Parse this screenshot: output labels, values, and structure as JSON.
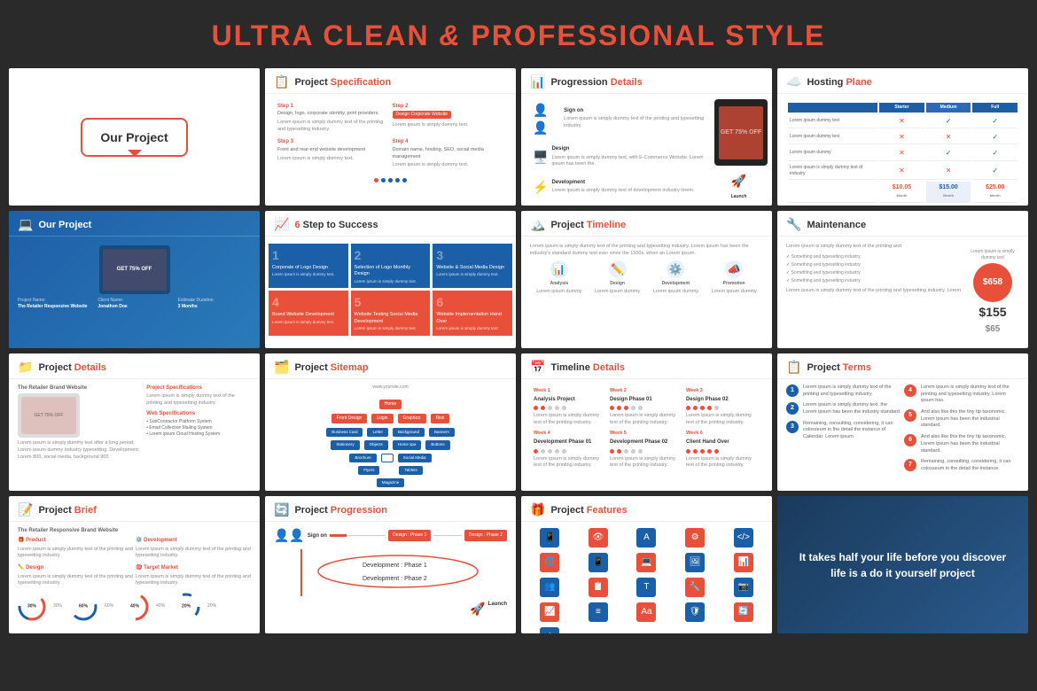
{
  "header": {
    "title_part1": "ULTRA CLEAN",
    "title_amp": " & ",
    "title_part2": "PROFESSIONAL STYLE"
  },
  "slides": [
    {
      "id": "slide-1",
      "type": "our-project-simple",
      "title": "Our Project"
    },
    {
      "id": "slide-2",
      "type": "project-specification",
      "title": "Project  Specification",
      "icon": "📋",
      "steps": [
        "Step 1",
        "Step 2",
        "Step 3",
        "Step 4"
      ]
    },
    {
      "id": "slide-3",
      "type": "progression-details",
      "title": "Progression Details",
      "icon": "📊",
      "items": [
        "Sign on",
        "Design",
        "Development"
      ]
    },
    {
      "id": "slide-4",
      "type": "hosting-plane",
      "title": "Hosting Plane",
      "icon": "☁️",
      "plans": [
        "Starter",
        "Medium",
        "Full"
      ],
      "prices": [
        "$10.05",
        "$15.00",
        "$25.00"
      ]
    },
    {
      "id": "slide-5",
      "type": "our-project-blue",
      "title": "Our Project",
      "icon": "💻",
      "project_name": "The Retailer Responsive Website",
      "client": "Jonathon Doe",
      "duration": "3 Months"
    },
    {
      "id": "slide-6",
      "type": "step-to-success",
      "title": "6 Step to Success",
      "icon": "📈",
      "steps": [
        {
          "num": "1",
          "title": "Corporate of Logo Design"
        },
        {
          "num": "2",
          "title": "Selection of Logo Monthly Design"
        },
        {
          "num": "3",
          "title": "Website & Social Media Design"
        },
        {
          "num": "4",
          "title": "Brand Website Development"
        },
        {
          "num": "5",
          "title": "Website Testing Social Media Development"
        },
        {
          "num": "6",
          "title": "Website Implementation Hand Over"
        }
      ]
    },
    {
      "id": "slide-7",
      "type": "project-timeline",
      "title": "Project Timeline",
      "icon": "🏔️",
      "phases": [
        "Analysis",
        "Design",
        "Development",
        "Promotion"
      ]
    },
    {
      "id": "slide-8",
      "type": "maintenance",
      "title": "Maintenance",
      "icon": "🔧",
      "prices": [
        "$658",
        "$155",
        "$65"
      ]
    },
    {
      "id": "slide-9",
      "type": "project-details",
      "title": "Project  Details",
      "icon": "📁",
      "subtitle": "The Retailer Brand Website"
    },
    {
      "id": "slide-10",
      "type": "project-sitemap",
      "title": "Project Sitemap",
      "icon": "🗂️",
      "nodes": [
        "Home",
        "Front Design",
        "Login",
        "Graphics",
        "Risk"
      ]
    },
    {
      "id": "slide-11",
      "type": "timeline-details",
      "title": "Timeline Details",
      "icon": "📅",
      "weeks": [
        {
          "label": "Week 1",
          "title": "Analysis Project"
        },
        {
          "label": "Week 2",
          "title": "Design Phase 01"
        },
        {
          "label": "Week 3",
          "title": "Design Phase 02"
        },
        {
          "label": "Week 4",
          "title": "Development Phase 01"
        },
        {
          "label": "Week 5",
          "title": "Development Phase 02"
        },
        {
          "label": "Week 6",
          "title": "Client Hand Over"
        }
      ]
    },
    {
      "id": "slide-12",
      "type": "project-terms",
      "title": "Project  Terms",
      "icon": "📋",
      "items": [
        "1",
        "2",
        "3",
        "4",
        "5",
        "6",
        "7"
      ]
    },
    {
      "id": "slide-13",
      "type": "project-brief",
      "title": "Project  Brief",
      "icon": "📝",
      "subtitle": "The Retailer Responsive Brand Website",
      "sections": [
        "Product",
        "Development",
        "Design",
        "Target Market"
      ]
    },
    {
      "id": "slide-14",
      "type": "project-progression",
      "title": "Project Progression",
      "icon": "🔄",
      "phases": [
        "Sign on",
        "Design : Phase 1",
        "Design : Phase 2",
        "Development : Phase 1",
        "Development : Phase 2",
        "Launch"
      ]
    },
    {
      "id": "slide-15",
      "type": "project-features",
      "title": "Project  Features",
      "icon": "🎁",
      "features": [
        "Responsive Design",
        "Eye Tracking",
        "Typography",
        "Settings",
        "Code",
        "Globe",
        "Mobile",
        "Tablet",
        "Photos",
        "Statistics",
        "Team",
        "Dashboard",
        "Text",
        "Tools",
        "Camera",
        "Chart",
        "List",
        "Alphabet",
        "Shield",
        "Refresh",
        "Alert"
      ]
    },
    {
      "id": "slide-16",
      "type": "quote",
      "text": "It takes half your life before you discover life is a do it yourself project"
    }
  ],
  "lorem": "Lorem ipsum is simply dummy text of the printing and typesetting industry. Lorem ipsum has been the industry's standard dummy text ever since."
}
